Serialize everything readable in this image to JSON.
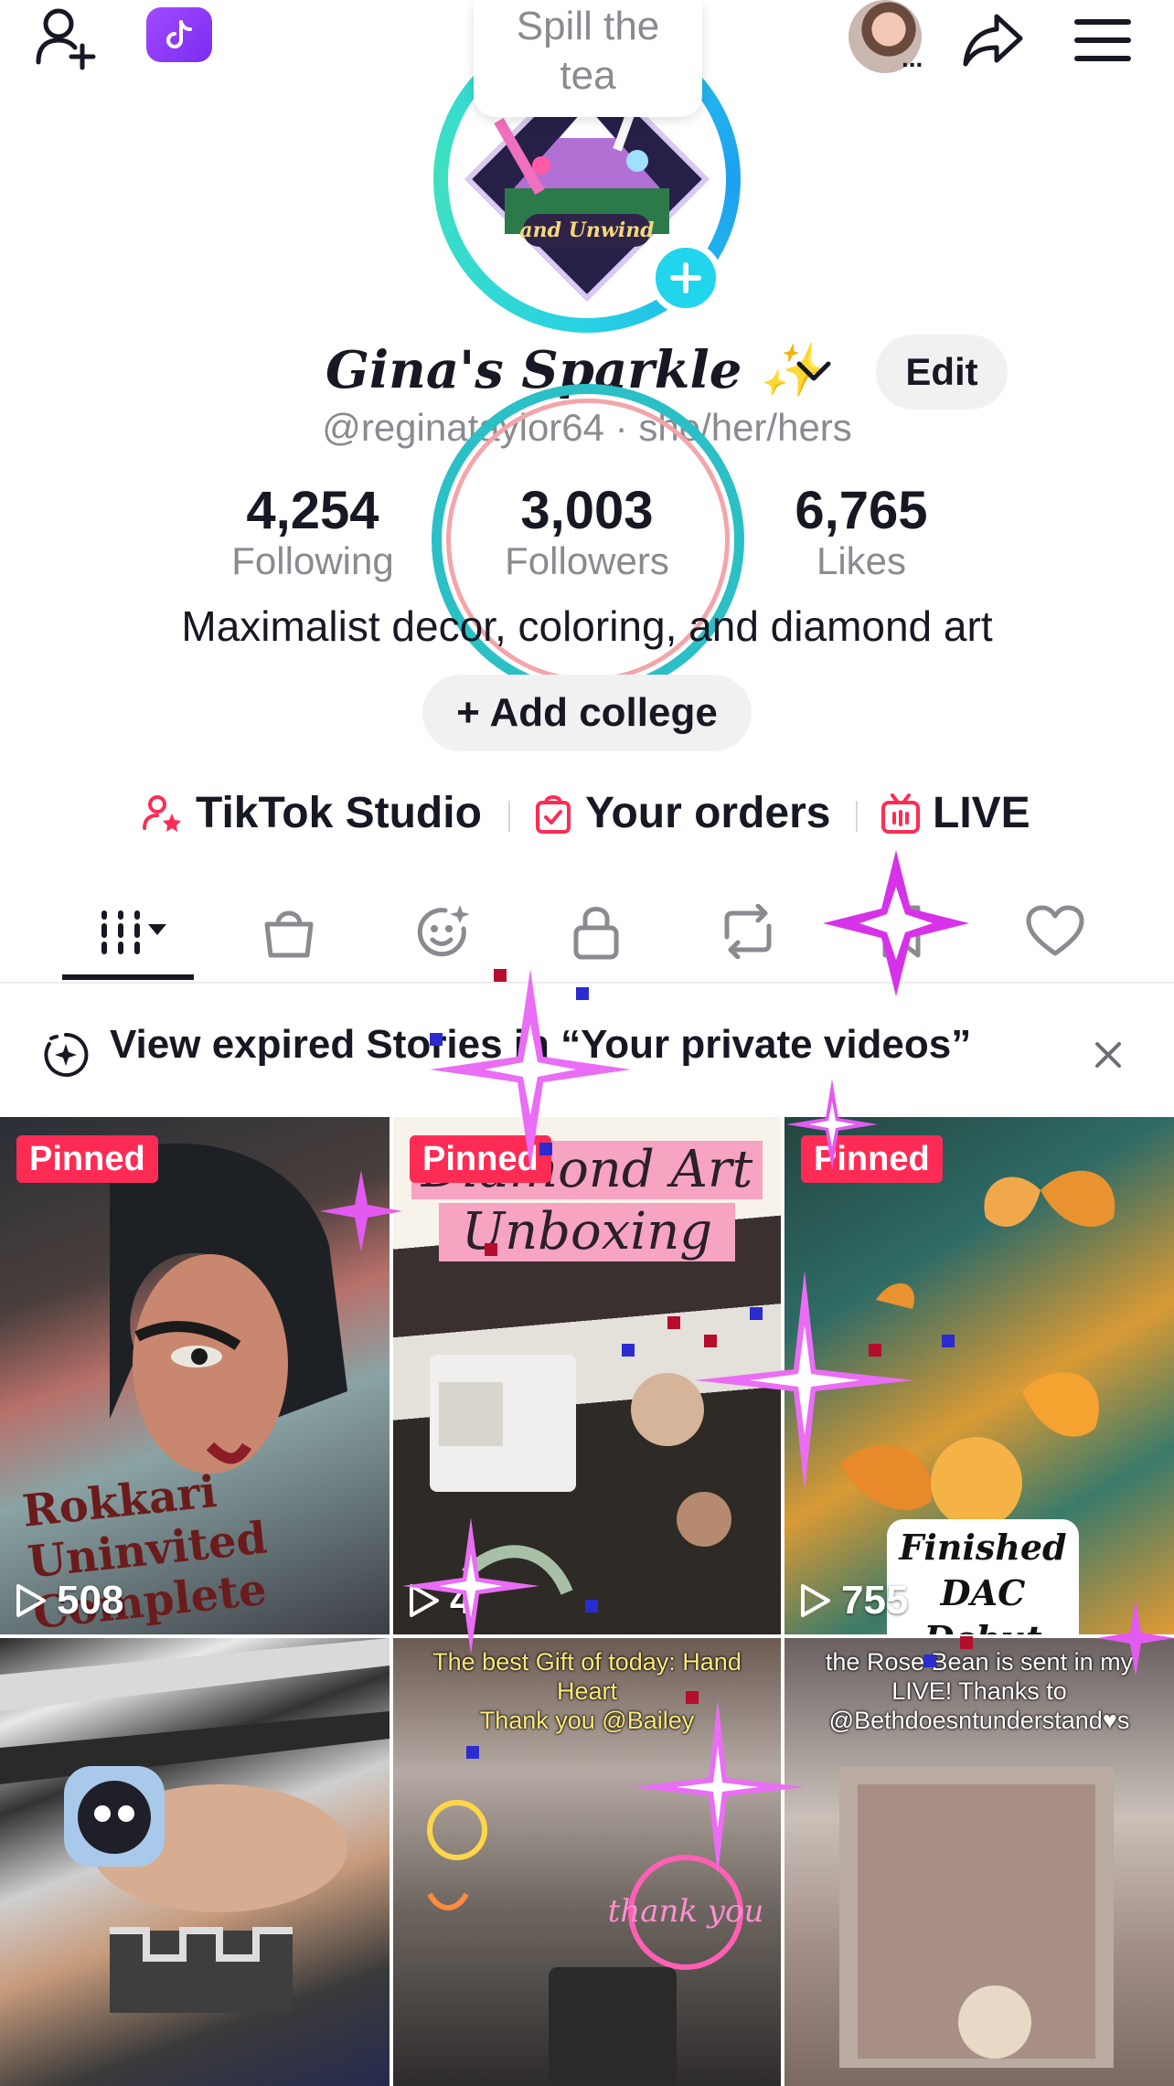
{
  "topbar": {
    "add_user_icon": "add-friend-icon",
    "studio_icon": "tiktok-studio-app-icon",
    "avatar_dots": "...",
    "share_icon": "share-icon",
    "menu_icon": "hamburger-menu-icon"
  },
  "tooltip": {
    "line1": "Spill the",
    "line2": "tea"
  },
  "profile": {
    "display_name": "Gina's Sparkle ✨",
    "edit_label": "Edit",
    "handle_line": "@reginataylor64 · she/her/hers",
    "stats": [
      {
        "value": "4,254",
        "label": "Following"
      },
      {
        "value": "3,003",
        "label": "Followers"
      },
      {
        "value": "6,765",
        "label": "Likes"
      }
    ],
    "bio": "Maximalist decor, coloring, and diamond art",
    "add_college": "+ Add college"
  },
  "links": [
    {
      "label": "TikTok Studio",
      "icon": "creator-star-icon"
    },
    {
      "label": "Your orders",
      "icon": "orders-bag-icon"
    },
    {
      "label": "LIVE",
      "icon": "live-tv-icon"
    }
  ],
  "tabs": [
    {
      "name": "videos",
      "icon": "grid-icon",
      "active": true
    },
    {
      "name": "shop",
      "icon": "shopping-bag-icon"
    },
    {
      "name": "avatar",
      "icon": "sticker-face-icon"
    },
    {
      "name": "private",
      "icon": "lock-icon"
    },
    {
      "name": "reposts",
      "icon": "repost-icon"
    },
    {
      "name": "favorites",
      "icon": "bookmark-icon"
    },
    {
      "name": "liked",
      "icon": "heart-icon"
    }
  ],
  "banner": {
    "text": "View expired Stories in “Your private videos”",
    "close_icon": "close-icon"
  },
  "videos": [
    {
      "pinned": "Pinned",
      "views": "508",
      "overlay": "Rokkari\nUninvited\nComplete"
    },
    {
      "pinned": "Pinned",
      "views": "4",
      "overlay": "Diamond Art\nUnboxing"
    },
    {
      "pinned": "Pinned",
      "views": "755",
      "overlay": "Finished\nDAC\nDebut"
    },
    {
      "views": "",
      "overlay": ""
    },
    {
      "views": "",
      "overlay": "The best Gift of today: Hand\nHeart\nThank you @Bailey"
    },
    {
      "views": "",
      "overlay": "the Rose Bean is sent in my\nLIVE! Thanks to\n@Bethdoesntunderstand♥s"
    }
  ],
  "colors": {
    "accent": "#fe2c55",
    "ring": "#20d5ec",
    "text": "#161823",
    "muted": "#8a8b91"
  }
}
